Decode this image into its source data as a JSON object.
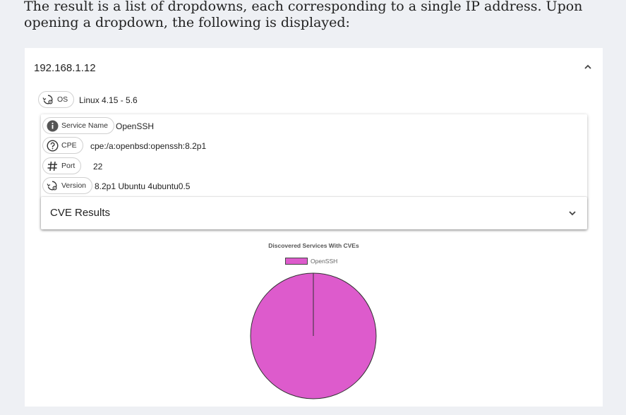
{
  "intro_text": "The result is a list of dropdowns, each corresponding to a single IP address. Upon opening a dropdown, the following is displayed:",
  "accordion": {
    "ip": "192.168.1.12",
    "os": {
      "label": "OS",
      "value": "Linux 4.15 - 5.6"
    },
    "service": {
      "name": {
        "label": "Service Name",
        "value": "OpenSSH"
      },
      "cpe": {
        "label": "CPE",
        "value": "cpe:/a:openbsd:openssh:8.2p1"
      },
      "port": {
        "label": "Port",
        "value": "22"
      },
      "version": {
        "label": "Version",
        "value": "8.2p1 Ubuntu 4ubuntu0.5"
      }
    },
    "cve_results_label": "CVE Results"
  },
  "icons": {
    "os": "history-settings-icon",
    "service": "info-icon",
    "cpe": "help-circle-icon",
    "port": "hash-icon",
    "version": "history-settings-icon",
    "expand": "chevron-up-icon",
    "cve_expand": "chevron-down-icon"
  },
  "chart_data": {
    "type": "pie",
    "title": "Discovered Services With CVEs",
    "labels": [
      "OpenSSH"
    ],
    "values": [
      1
    ],
    "colors": [
      "#dd5bcc"
    ],
    "legend_position": "top"
  }
}
